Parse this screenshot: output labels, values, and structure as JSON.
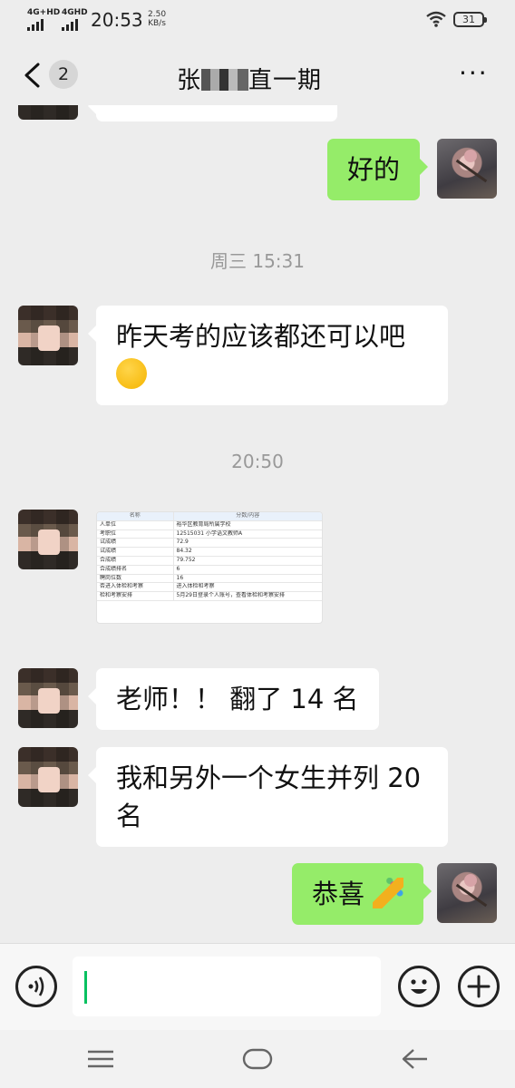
{
  "status_bar": {
    "signal_1": "4G+HD",
    "signal_2": "4GHD",
    "time": "20:53",
    "speed_value": "2.50",
    "speed_unit": "KB/s",
    "battery": "31"
  },
  "header": {
    "unread_count": "2",
    "title_pre": "张",
    "title_post": "直一期",
    "more_label": "···"
  },
  "messages": [
    {
      "from": "me",
      "text": "好的"
    },
    {
      "timestamp": "周三 15:31"
    },
    {
      "from": "peer",
      "text": "昨天考的应该都还可以吧",
      "emoji": "shush-face"
    },
    {
      "timestamp": "20:50"
    },
    {
      "from": "peer",
      "type": "image"
    },
    {
      "from": "peer",
      "text": "老师！！ 翻了 14 名"
    },
    {
      "from": "peer",
      "text": "我和另外一个女生并列 20 名"
    },
    {
      "from": "me",
      "text": "恭喜",
      "emoji": "party-popper"
    }
  ],
  "score_image": {
    "header": [
      "名称",
      "分数/内容"
    ],
    "rows": [
      [
        "人单位",
        "裕华区教育局所属学校"
      ],
      [
        "考职位",
        "12515031 小学语文教师A"
      ],
      [
        "试成绩",
        "72.9"
      ],
      [
        "试成绩",
        "84.32"
      ],
      [
        "合成绩",
        "79.752"
      ],
      [
        "合成绩排名",
        "6"
      ],
      [
        "聘岗位数",
        "16"
      ],
      [
        "否进入体检和考察",
        "进入体检和考察"
      ],
      [
        "检和考察安排",
        "5月29日登录个人账号，查看体检和考察安排"
      ]
    ]
  },
  "icons": {
    "voice": "voice-input-icon",
    "emoji": "emoji-icon",
    "add": "plus-icon",
    "menu": "menu-icon",
    "home": "home-icon",
    "back": "back-arrow-icon"
  },
  "colors": {
    "outgoing_bubble": "#95ec69",
    "incoming_bubble": "#ffffff",
    "background": "#ededed",
    "caret": "#07c160"
  }
}
